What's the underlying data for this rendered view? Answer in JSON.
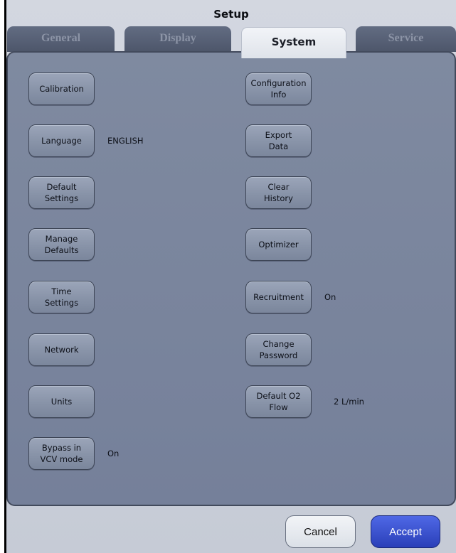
{
  "window": {
    "title": "Setup"
  },
  "tabs": [
    {
      "label": "General",
      "active": false
    },
    {
      "label": "Display",
      "active": false
    },
    {
      "label": "System",
      "active": true
    },
    {
      "label": "Service",
      "active": false
    }
  ],
  "left_column": [
    {
      "label": "Calibration",
      "value": ""
    },
    {
      "label": "Language",
      "value": "ENGLISH"
    },
    {
      "label": "Default\nSettings",
      "value": ""
    },
    {
      "label": "Manage\nDefaults",
      "value": ""
    },
    {
      "label": "Time\nSettings",
      "value": ""
    },
    {
      "label": "Network",
      "value": ""
    },
    {
      "label": "Units",
      "value": ""
    },
    {
      "label": "Bypass in\nVCV mode",
      "value": "On"
    }
  ],
  "right_column": [
    {
      "label": "Configuration\nInfo",
      "value": ""
    },
    {
      "label": "Export\nData",
      "value": ""
    },
    {
      "label": "Clear\nHistory",
      "value": ""
    },
    {
      "label": "Optimizer",
      "value": ""
    },
    {
      "label": "Recruitment",
      "value": "On"
    },
    {
      "label": "Change\nPassword",
      "value": ""
    },
    {
      "label": "Default O2 Flow",
      "value": "2 L/min"
    }
  ],
  "footer": {
    "cancel_label": "Cancel",
    "accept_label": "Accept"
  },
  "colors": {
    "panel": "#7f8aa0",
    "button": "#8893a8",
    "accept": "#2a3fb8",
    "tab_inactive": "#4d566a"
  }
}
